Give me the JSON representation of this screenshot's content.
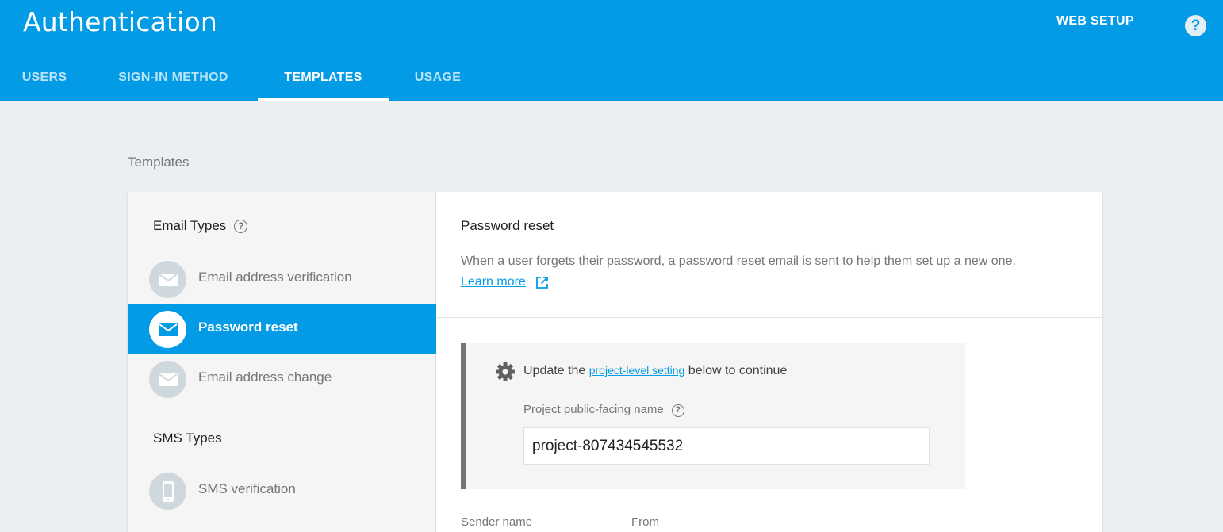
{
  "header": {
    "title": "Authentication",
    "web_setup": "WEB SETUP",
    "help_glyph": "?",
    "tabs": [
      {
        "label": "USERS"
      },
      {
        "label": "SIGN-IN METHOD"
      },
      {
        "label": "TEMPLATES"
      },
      {
        "label": "USAGE"
      }
    ],
    "active_tab": "TEMPLATES"
  },
  "section": {
    "label": "Templates"
  },
  "sidebar": {
    "email_types_title": "Email Types",
    "email_items": [
      {
        "label": "Email address verification",
        "icon": "mail-icon"
      },
      {
        "label": "Password reset",
        "icon": "mail-icon",
        "active": true
      },
      {
        "label": "Email address change",
        "icon": "mail-icon"
      }
    ],
    "sms_types_title": "SMS Types",
    "sms_items": [
      {
        "label": "SMS verification",
        "icon": "phone-icon"
      }
    ]
  },
  "content": {
    "title": "Password reset",
    "description": "When a user forgets their password, a password reset email is sent to help them set up a new one.",
    "learn_more": "Learn more",
    "notice": {
      "prefix": "Update the ",
      "link": "project-level setting",
      "suffix": " below to continue",
      "field_label": "Project public-facing name",
      "field_value": "project-807434545532"
    },
    "sender_name_label": "Sender name",
    "from_label": "From"
  },
  "colors": {
    "primary": "#039be5",
    "background": "#eceff1",
    "sidebar_bg": "#f5f5f5",
    "muted_text": "#757575"
  }
}
